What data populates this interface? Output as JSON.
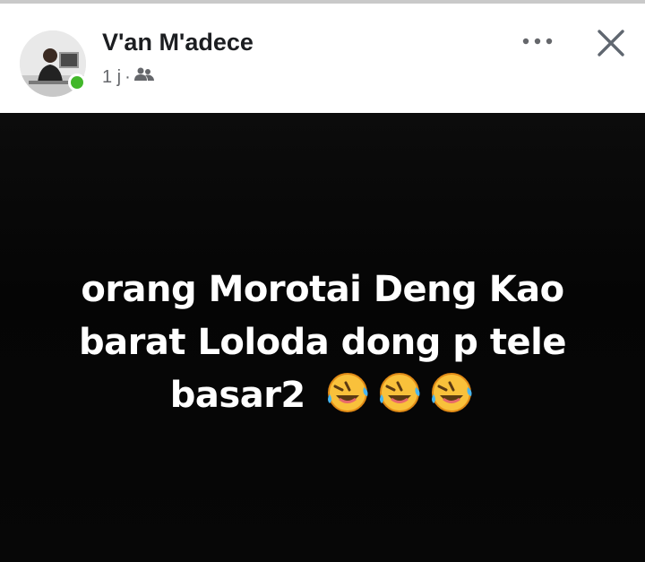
{
  "post": {
    "author": "V'an M'adece",
    "time": "1 j",
    "separator": "·",
    "audience_icon": "friends-icon",
    "more_icon": "more-dots-icon",
    "close_icon": "close-icon",
    "online": true,
    "colors": {
      "online": "#42b72a",
      "image_bg": "#060606",
      "text": "#ffffff"
    }
  },
  "image_text": {
    "lines": [
      "orang Morotai Deng Kao",
      "barat Loloda dong p tele",
      "basar2"
    ],
    "emoji": "rolling-on-the-floor-laughing-face",
    "emoji_count": 3
  }
}
